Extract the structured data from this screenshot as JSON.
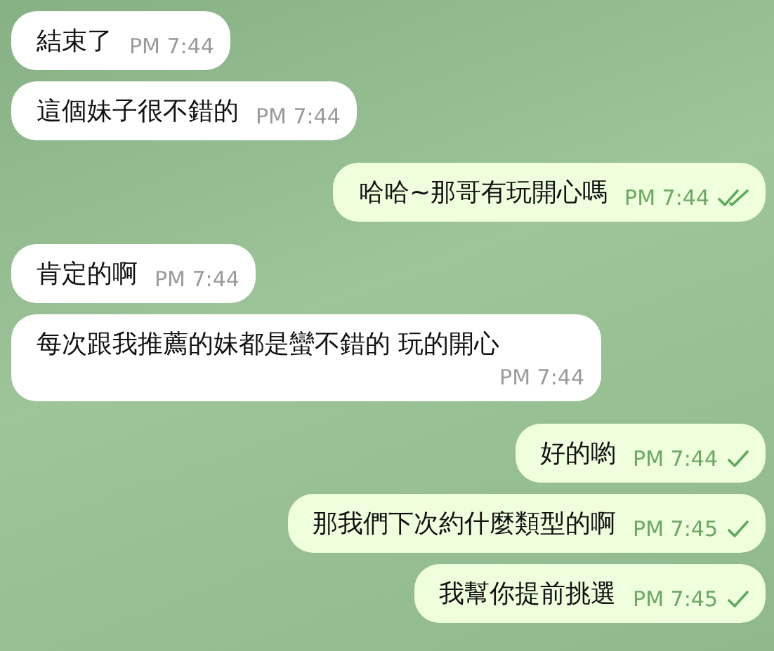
{
  "messages": [
    {
      "kind": "in",
      "text": "結束了",
      "time": "PM 7:44"
    },
    {
      "kind": "in",
      "text": "這個妹子很不錯的",
      "time": "PM 7:44"
    },
    {
      "kind": "out",
      "text": "哈哈~那哥有玩開心嗎",
      "time": "PM 7:44",
      "read": true
    },
    {
      "kind": "in",
      "text": "肯定的啊",
      "time": "PM 7:44"
    },
    {
      "kind": "in",
      "text": "每次跟我推薦的妹都是蠻不錯的 玩的開心",
      "time": "PM 7:44"
    },
    {
      "kind": "out",
      "text": "好的喲",
      "time": "PM 7:44",
      "read": false
    },
    {
      "kind": "out",
      "text": "那我們下次約什麼類型的啊",
      "time": "PM 7:45",
      "read": false
    },
    {
      "kind": "out",
      "text": "我幫你提前挑選",
      "time": "PM 7:45",
      "read": false
    }
  ]
}
